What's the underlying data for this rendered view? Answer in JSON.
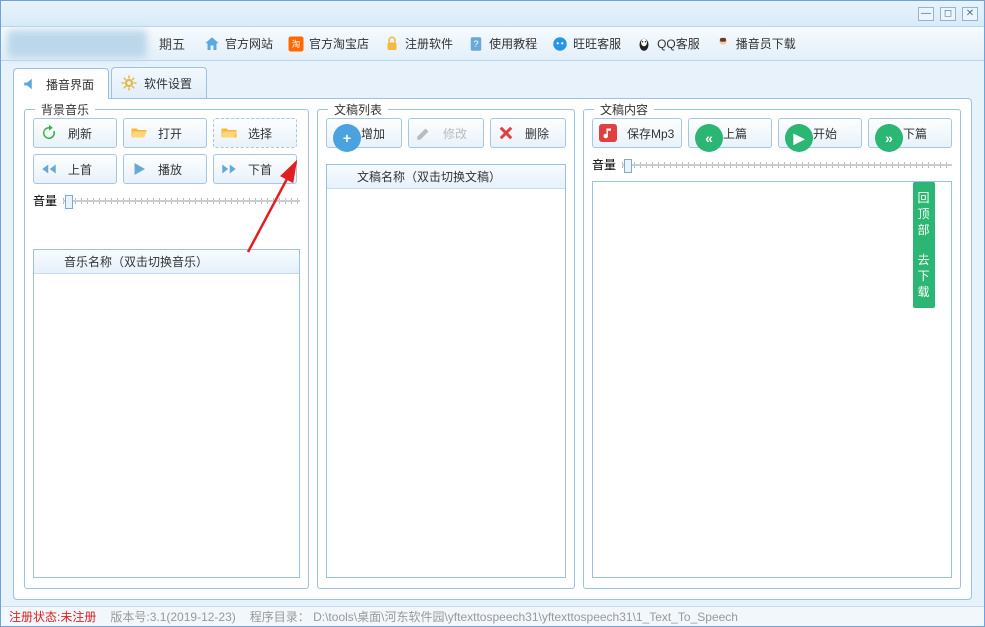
{
  "titlebar": {
    "date_suffix": "期五"
  },
  "toolbar": {
    "items": [
      {
        "label": "官方网站"
      },
      {
        "label": "官方淘宝店"
      },
      {
        "label": "注册软件"
      },
      {
        "label": "使用教程"
      },
      {
        "label": "旺旺客服"
      },
      {
        "label": "QQ客服"
      },
      {
        "label": "播音员下载"
      }
    ]
  },
  "tabs": {
    "t1": "播音界面",
    "t2": "软件设置"
  },
  "panels": {
    "bgm": {
      "title": "背景音乐",
      "refresh": "刷新",
      "open": "打开",
      "choose": "选择",
      "prev": "上首",
      "play": "播放",
      "next": "下首",
      "volume": "音量",
      "list_header": "音乐名称（双击切换音乐）"
    },
    "doclist": {
      "title": "文稿列表",
      "add": "增加",
      "edit": "修改",
      "delete": "删除",
      "list_header": "文稿名称（双击切换文稿）"
    },
    "doc": {
      "title": "文稿内容",
      "save": "保存Mp3",
      "prev": "上篇",
      "start": "开始",
      "next": "下篇",
      "volume": "音量"
    }
  },
  "green_strip": {
    "l1": "回",
    "l2": "顶",
    "l3": "部",
    "l4": "去",
    "l5": "下",
    "l6": "载"
  },
  "status": {
    "reg_label": "注册状态:",
    "reg_value": "未注册",
    "version": "版本号:3.1(2019-12-23)",
    "dir": "程序目录： D:\\tools\\桌面\\河东软件园\\yftexttospeech31\\yftexttospeech31\\1_Text_To_Speech"
  }
}
